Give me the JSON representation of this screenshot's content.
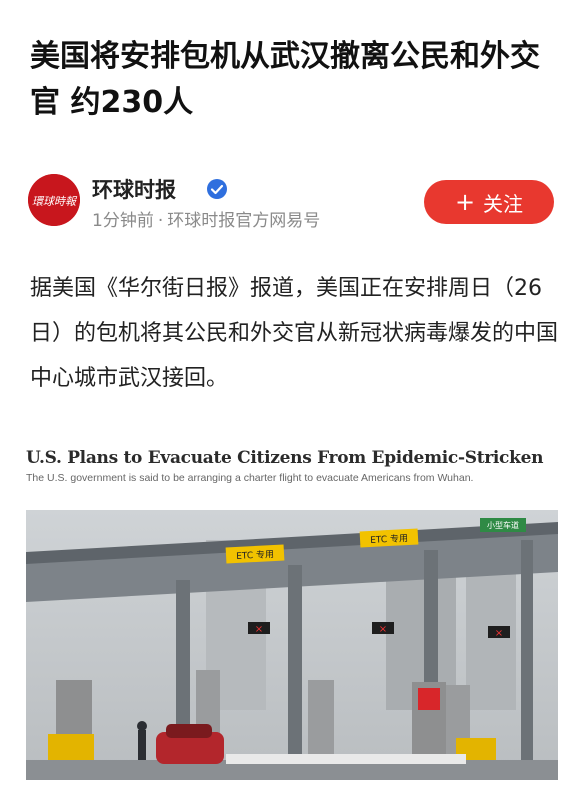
{
  "article": {
    "headline": "美国将安排包机从武汉撤离公民和外交官 约230人",
    "author": {
      "name": "环球时报",
      "avatar_text": "環球時報",
      "time_ago": "1分钟前",
      "source": "环球时报官方网易号",
      "follow_label": "关注",
      "follow_icon": "plus-icon"
    },
    "body": "据美国《华尔街日报》报道，美国正在安排周日（26日）的包机将其公民和外交官从新冠状病毒爆发的中国中心城市武汉接回。",
    "figure": {
      "headline": "U.S. Plans to Evacuate Citizens From Epidemic-Stricken",
      "caption": "The U.S. government is said to be arranging a charter flight to evacuate Americans from Wuhan.",
      "signs": {
        "etc_left": "ETC 专用",
        "etc_right": "ETC 专用",
        "green_sign": "小型车道"
      }
    }
  },
  "colors": {
    "accent": "#e8382f",
    "brand_red": "#c8161d",
    "verified_blue": "#2f6fde"
  }
}
